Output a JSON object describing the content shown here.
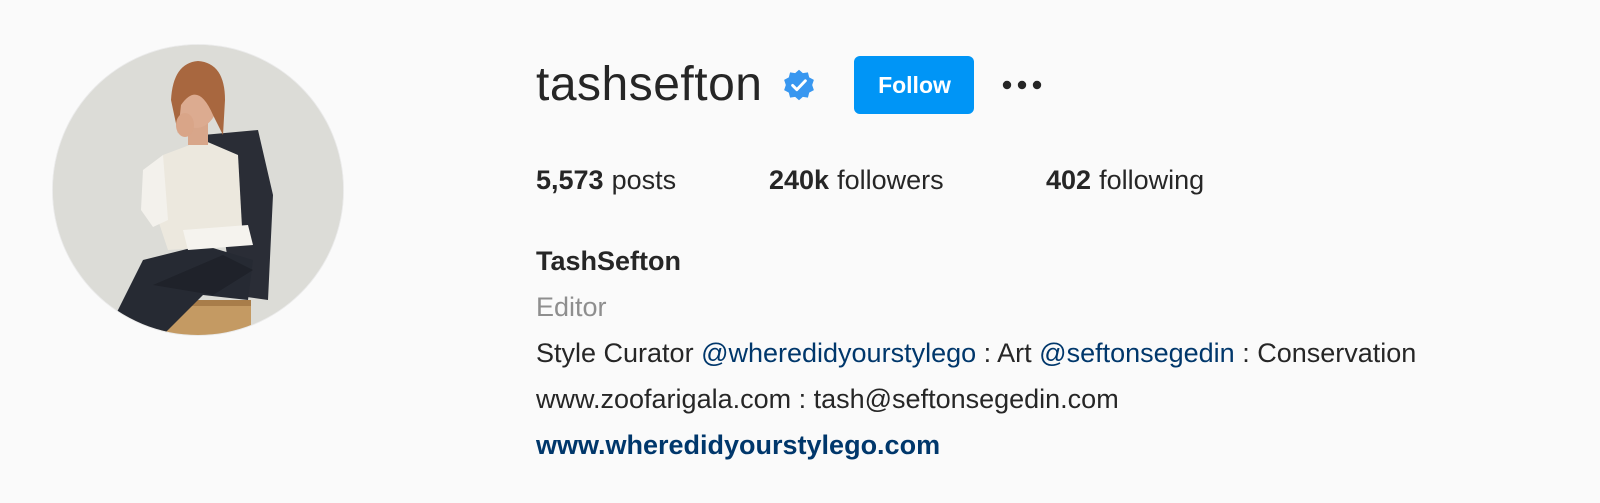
{
  "profile": {
    "username": "tashsefton",
    "follow_label": "Follow",
    "more_icon": "more-horizontal-icon",
    "verified_icon": "verified-badge-icon",
    "accent_color": "#0095f6",
    "verified_color": "#3897f0"
  },
  "stats": {
    "posts_count": "5,573",
    "posts_label": "posts",
    "followers_count": "240k",
    "followers_label": "followers",
    "following_count": "402",
    "following_label": "following"
  },
  "bio": {
    "full_name": "TashSefton",
    "category": "Editor",
    "line1_text1": "Style Curator ",
    "line1_mention1": "@wheredidyourstylego",
    "line1_text2": " : Art ",
    "line1_mention2": "@seftonsegedin",
    "line1_text3": " : Conservation",
    "line2": "www.zoofarigala.com : tash@seftonsegedin.com",
    "website": "www.wheredidyourstylego.com",
    "link_color": "#00376b"
  }
}
